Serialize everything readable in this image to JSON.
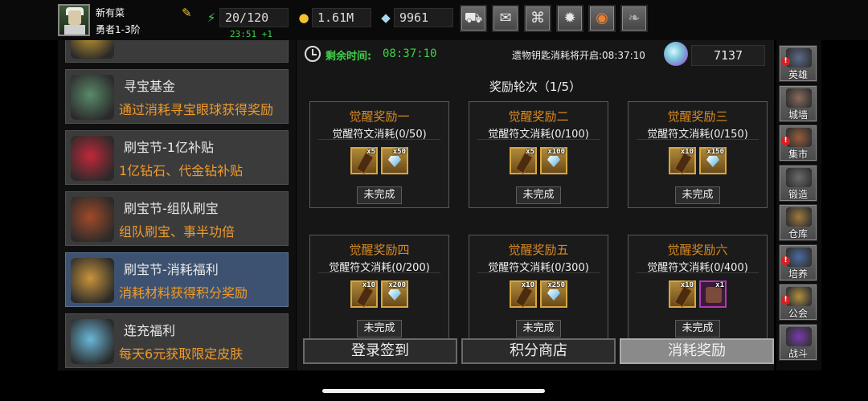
{
  "player": {
    "name": "新有菜",
    "rank": "勇者1-3阶"
  },
  "resources": {
    "energy": "20/120",
    "energy_timer": "23:51 +1",
    "gold": "1.61M",
    "diamonds": "9961"
  },
  "top_buttons": [
    "shop-cart-icon",
    "mail-icon",
    "gamepad-icon",
    "settings-gear-icon",
    "color-wheel-icon",
    "wings-icon"
  ],
  "events": [
    {
      "title": "",
      "desc": "",
      "img_color": "#c89a30"
    },
    {
      "title": "寻宝基金",
      "desc": "通过消耗寻宝眼球获得奖励",
      "img_color": "#5a8a6a"
    },
    {
      "title": "刷宝节-1亿补贴",
      "desc": "1亿钻石、代金钻补贴",
      "img_color": "#c02838"
    },
    {
      "title": "刷宝节-组队刷宝",
      "desc": "组队刷宝、事半功倍",
      "img_color": "#a04a28"
    },
    {
      "title": "刷宝节-消耗福利",
      "desc": "消耗材料获得积分奖励",
      "img_color": "#c8943a"
    },
    {
      "title": "连充福利",
      "desc": "每天6元获取限定皮肤",
      "img_color": "#6ab8d8"
    }
  ],
  "main": {
    "remain_label": "剩余时间:",
    "remain_time": "08:37:10",
    "key_text": "遗物钥匙消耗将开启:08:37:10",
    "crystal_count": "7137",
    "round_label": "奖励轮次（1/5）",
    "rewards": [
      {
        "title": "觉醒奖励一",
        "cond": "觉醒符文消耗(0/50)",
        "items": [
          {
            "type": "scroll",
            "qty": "x5"
          },
          {
            "type": "gem",
            "qty": "x50"
          }
        ],
        "status": "未完成"
      },
      {
        "title": "觉醒奖励二",
        "cond": "觉醒符文消耗(0/100)",
        "items": [
          {
            "type": "scroll",
            "qty": "x5"
          },
          {
            "type": "gem",
            "qty": "x100"
          }
        ],
        "status": "未完成"
      },
      {
        "title": "觉醒奖励三",
        "cond": "觉醒符文消耗(0/150)",
        "items": [
          {
            "type": "scroll",
            "qty": "x10"
          },
          {
            "type": "gem",
            "qty": "x150"
          }
        ],
        "status": "未完成"
      },
      {
        "title": "觉醒奖励四",
        "cond": "觉醒符文消耗(0/200)",
        "items": [
          {
            "type": "scroll",
            "qty": "x10"
          },
          {
            "type": "gem",
            "qty": "x200"
          }
        ],
        "status": "未完成"
      },
      {
        "title": "觉醒奖励五",
        "cond": "觉醒符文消耗(0/300)",
        "items": [
          {
            "type": "scroll",
            "qty": "x10"
          },
          {
            "type": "gem",
            "qty": "x250"
          }
        ],
        "status": "未完成"
      },
      {
        "title": "觉醒奖励六",
        "cond": "觉醒符文消耗(0/400)",
        "items": [
          {
            "type": "scroll",
            "qty": "x10"
          },
          {
            "type": "rune",
            "qty": "x1"
          }
        ],
        "status": "未完成"
      }
    ],
    "tabs": [
      "登录签到",
      "积分商店",
      "消耗奖励"
    ],
    "active_tab": 2
  },
  "right_nav": [
    {
      "label": "英雄",
      "alert": true,
      "color": "#5a6a8a"
    },
    {
      "label": "城墙",
      "alert": false,
      "color": "#8a6a5a"
    },
    {
      "label": "集市",
      "alert": true,
      "color": "#9a5a3a"
    },
    {
      "label": "锻造",
      "alert": false,
      "color": "#6a6a6a"
    },
    {
      "label": "仓库",
      "alert": false,
      "color": "#a07a3a"
    },
    {
      "label": "培养",
      "alert": true,
      "color": "#4a6aa0"
    },
    {
      "label": "公会",
      "alert": true,
      "color": "#b09040"
    },
    {
      "label": "战斗",
      "alert": false,
      "color": "#7a3ab0"
    }
  ]
}
